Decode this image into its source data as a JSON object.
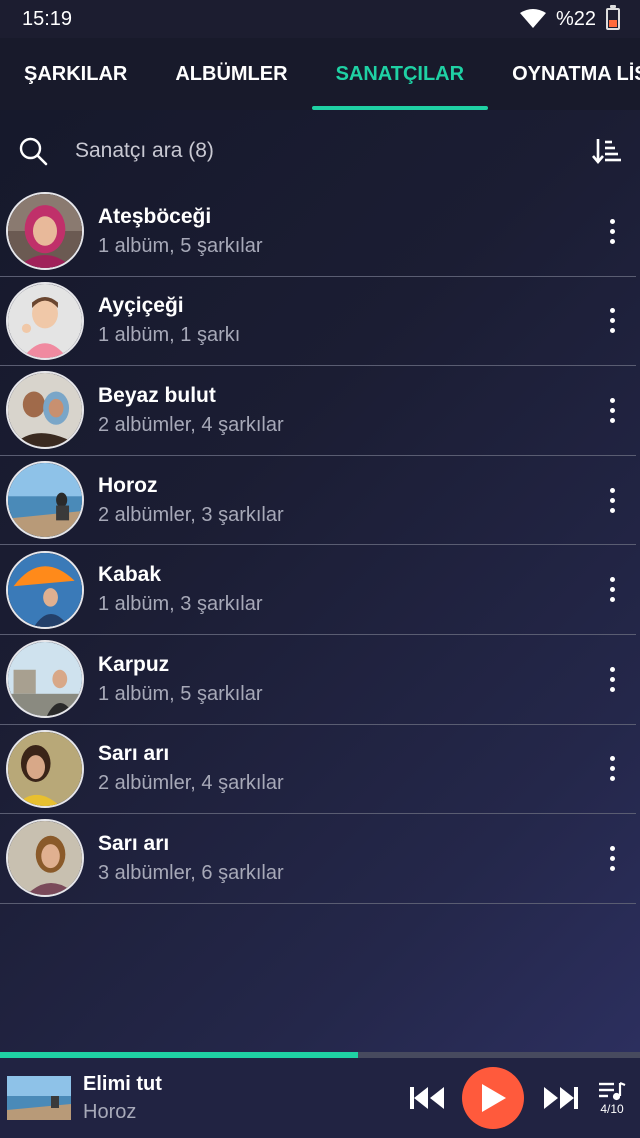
{
  "status": {
    "time": "15:19",
    "battery": "%22"
  },
  "tabs": [
    {
      "label": "ŞARKILAR"
    },
    {
      "label": "ALBÜMLER"
    },
    {
      "label": "SANATÇILAR",
      "active": true
    },
    {
      "label": "OYNATMA LİSTELERİ"
    }
  ],
  "search": {
    "placeholder": "Sanatçı ara (8)"
  },
  "artists": [
    {
      "name": "Ateşböceği",
      "info": "1 albüm, 5 şarkılar"
    },
    {
      "name": "Ayçiçeği",
      "info": "1 albüm, 1 şarkı"
    },
    {
      "name": "Beyaz bulut",
      "info": "2 albümler, 4 şarkılar"
    },
    {
      "name": "Horoz",
      "info": "2 albümler, 3 şarkılar"
    },
    {
      "name": "Kabak",
      "info": "1 albüm, 3 şarkılar"
    },
    {
      "name": "Karpuz",
      "info": "1 albüm, 5 şarkılar"
    },
    {
      "name": "Sarı arı",
      "info": "2 albümler, 4 şarkılar"
    },
    {
      "name": "Sarı arı",
      "info": "3 albümler, 6 şarkılar"
    }
  ],
  "player": {
    "title": "Elimi tut",
    "artist": "Horoz",
    "queue_position": "4/10",
    "progress": 0.56
  },
  "colors": {
    "accent": "#1fd1a4",
    "play": "#ff5a3c"
  }
}
